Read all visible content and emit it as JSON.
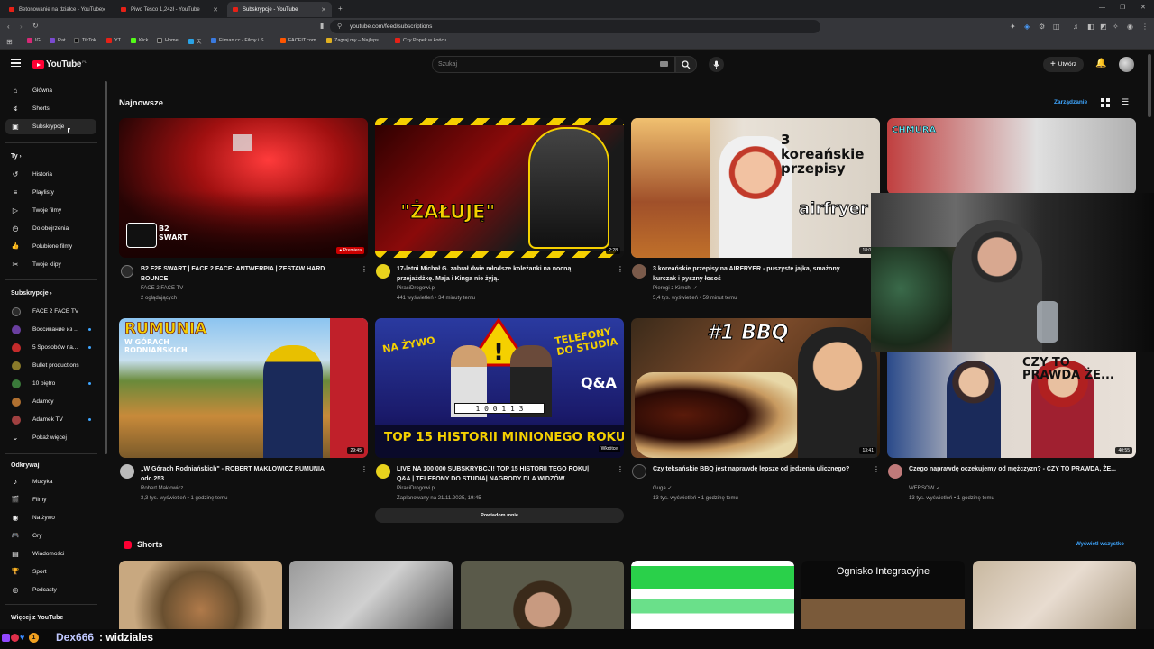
{
  "browser": {
    "tabs": [
      {
        "label": "Betonowanie na działce - YouTube",
        "active": false
      },
      {
        "label": "Piwo Tesco 1,24zł - YouTube",
        "active": false
      },
      {
        "label": "Subskrypcje - YouTube",
        "active": true
      }
    ],
    "url": "youtube.com/feed/subscriptions",
    "bookmarks": [
      "IG",
      "Rat",
      "TikTok",
      "YT",
      "Kick",
      "Home",
      "天",
      "Filman.cc - Filmy i S...",
      "FACEIT.com",
      "Zagraj.my – Najleps...",
      "Czy Popek w końcu..."
    ],
    "window_controls": [
      "—",
      "❐",
      "✕"
    ]
  },
  "header": {
    "logo_text": "YouTube",
    "logo_region": "PL",
    "search_placeholder": "Szukaj",
    "create_label": "Utwórz"
  },
  "sidebar": {
    "main": [
      {
        "label": "Główna",
        "icon": "home-icon",
        "glyph": "⌂"
      },
      {
        "label": "Shorts",
        "icon": "shorts-icon",
        "glyph": "↯"
      },
      {
        "label": "Subskrypcje",
        "icon": "subscriptions-icon",
        "glyph": "▣",
        "active": true
      }
    ],
    "you_header": "Ty",
    "you": [
      {
        "label": "Historia",
        "icon": "history-icon",
        "glyph": "↺"
      },
      {
        "label": "Playlisty",
        "icon": "playlists-icon",
        "glyph": "≡"
      },
      {
        "label": "Twoje filmy",
        "icon": "your-videos-icon",
        "glyph": "▷"
      },
      {
        "label": "Do obejrzenia",
        "icon": "watch-later-icon",
        "glyph": "◷"
      },
      {
        "label": "Polubione filmy",
        "icon": "liked-icon",
        "glyph": "👍"
      },
      {
        "label": "Twoje klipy",
        "icon": "clips-icon",
        "glyph": "✂"
      }
    ],
    "subs_header": "Subskrypcje",
    "subs": [
      {
        "label": "FACE 2 FACE TV",
        "color": "#2b2b2b",
        "dot": false
      },
      {
        "label": "Воссивание из ...",
        "color": "#6a3fa0",
        "dot": true
      },
      {
        "label": "5 Sposobów na...",
        "color": "#c42b2b",
        "dot": true
      },
      {
        "label": "Bullet productions",
        "color": "#8a7a2a",
        "dot": false
      },
      {
        "label": "10 piętro",
        "color": "#3a7a3a",
        "dot": true
      },
      {
        "label": "Adamcy",
        "color": "#b07030",
        "dot": false
      },
      {
        "label": "Adamek TV",
        "color": "#a04040",
        "dot": true
      },
      {
        "label": "Pokaż więcej",
        "color": "",
        "dot": false
      }
    ],
    "explore_header": "Odkrywaj",
    "explore": [
      {
        "label": "Muzyka",
        "icon": "music-icon",
        "glyph": "♪"
      },
      {
        "label": "Filmy",
        "icon": "movies-icon",
        "glyph": "🎬"
      },
      {
        "label": "Na żywo",
        "icon": "live-icon",
        "glyph": "◉"
      },
      {
        "label": "Gry",
        "icon": "gaming-icon",
        "glyph": "🎮"
      },
      {
        "label": "Wiadomości",
        "icon": "news-icon",
        "glyph": "▤"
      },
      {
        "label": "Sport",
        "icon": "sports-icon",
        "glyph": "🏆"
      },
      {
        "label": "Podcasty",
        "icon": "podcasts-icon",
        "glyph": "◎"
      }
    ],
    "more_header": "Więcej z YouTube"
  },
  "main": {
    "section_title": "Najnowsze",
    "manage_label": "Zarządzanie",
    "videos": [
      {
        "title": "B2 F2F SWART | FACE 2 FACE: ANTWERPIA | ZESTAW HARD BOUNCE",
        "channel": "FACE 2 FACE TV",
        "meta": "2 oglądających",
        "badge": "● Premiera",
        "thumb_text": "B2\nSWART",
        "avatar_color": "#2b2b2b"
      },
      {
        "title": "17-letni Michał G. zabrał dwie młodsze koleżanki na nocną przejażdżkę. Maja i Kinga nie żyją.",
        "channel": "PiraciDrogowi.pl",
        "meta": "441 wyświetleń • 34 minuty temu",
        "badge": "2:28",
        "thumb_text": "\"ŻAŁUJĘ\"",
        "avatar_color": "#e8d21d"
      },
      {
        "title": "3 koreańskie przepisy na AIRFRYER - puszyste jajka, smażony kurczak i pyszny łosoś",
        "channel": "Pierogi z Kimchi ✓",
        "meta": "5,4 tys. wyświetleń • 59 minut temu",
        "badge": "18:09",
        "thumb_text": "3 koreańskie przepisy",
        "avatar_color": "#7a5a4a"
      },
      {
        "title": "",
        "channel": "",
        "meta": "",
        "badge": "",
        "thumb_text": "CHMURA",
        "avatar_color": "#555"
      },
      {
        "title": "„W Górach Rodniańskich\" - ROBERT MAKŁOWICZ RUMUNIA odc.253",
        "channel": "Robert Makłowicz",
        "meta": "3,3 tys. wyświetleń • 1 godzinę temu",
        "badge": "29:45",
        "thumb_text": "RUMUNIA",
        "avatar_color": "#bbb"
      },
      {
        "title": "LIVE NA 100 000 SUBSKRYBCJI! TOP 15 HISTORII TEGO ROKU| Q&A | TELEFONY DO STUDIA| NAGRODY DLA WIDZÓW",
        "channel": "PiraciDrogowi.pl",
        "meta": "Zaplanowany na 21.11.2025, 19:45",
        "badge": "Wkrótce",
        "thumb_text": "TOP 15 HISTORII MINIONEGO ROKU",
        "avatar_color": "#e8d21d"
      },
      {
        "title": "Czy teksańskie BBQ jest naprawdę lepsze od jedzenia ulicznego?",
        "channel": "Guga ✓",
        "meta": "13 tys. wyświetleń • 1 godzinę temu",
        "badge": "13:41",
        "thumb_text": "#1 BBQ",
        "avatar_color": "#1a1a1a"
      },
      {
        "title": "Czego naprawdę oczekujemy od mężczyzn? - CZY TO PRAWDA, ŻE...",
        "channel": "WERSOW ✓",
        "meta": "13 tys. wyświetleń • 1 godzinę temu",
        "badge": "40:55",
        "thumb_text": "CZY TO PRAWDA ŻE...",
        "avatar_color": "#c07a7a"
      }
    ],
    "remind_label": "Powiadom mnie",
    "shorts_title": "Shorts",
    "show_all_label": "Wyświetl wszystko",
    "shorts": [
      {
        "text": ""
      },
      {
        "text": ""
      },
      {
        "text": ""
      },
      {
        "text": ""
      },
      {
        "text": "Ognisko Integracyjne"
      },
      {
        "text": ""
      }
    ]
  },
  "chat": {
    "username": "Dex666",
    "message": ": widziales"
  },
  "colors": {
    "bg": "#0f0f0f",
    "accent_red": "#ff0033",
    "link_blue": "#3ea6ff"
  }
}
